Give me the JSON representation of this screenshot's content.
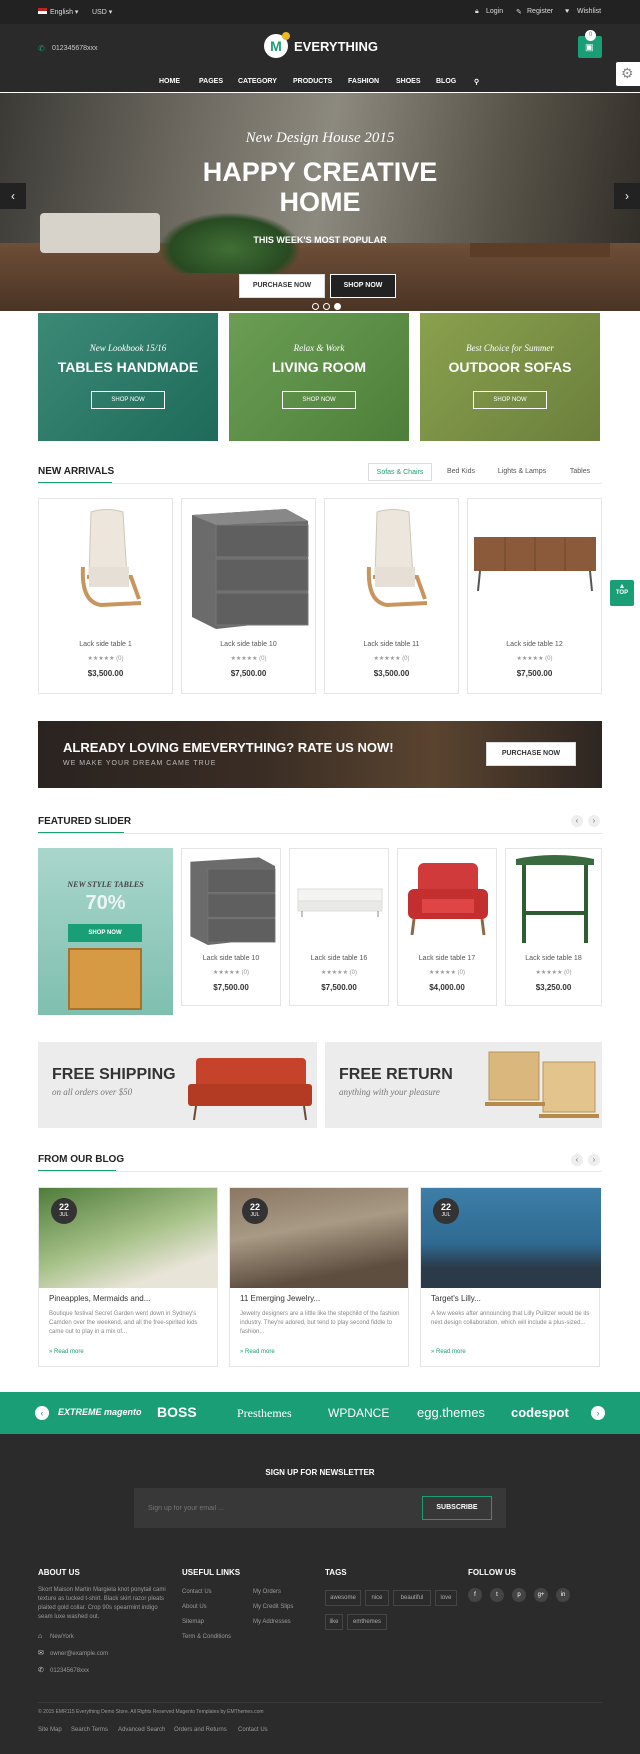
{
  "topbar": {
    "language": "English ▾",
    "currency": "USD ▾",
    "login": "Login",
    "register": "Register",
    "wishlist": "Wishlist"
  },
  "header": {
    "phone": "012345678xxx",
    "logo": "EVERYTHING",
    "cart_count": "0"
  },
  "nav": [
    "HOME",
    "PAGES",
    "CATEGORY",
    "PRODUCTS",
    "FASHION",
    "SHOES",
    "BLOG"
  ],
  "hero": {
    "subtitle": "New Design House 2015",
    "title_line1": "HAPPY CREATIVE",
    "title_line2": "HOME",
    "tagline": "THIS WEEK'S MOST POPULAR",
    "btn1": "PURCHASE NOW",
    "btn2": "SHOP NOW"
  },
  "banners": [
    {
      "sub": "New Lookbook 15/16",
      "title": "TABLES HANDMADE",
      "btn": "SHOP NOW"
    },
    {
      "sub": "Relax & Work",
      "title": "LIVING ROOM",
      "btn": "SHOP NOW"
    },
    {
      "sub": "Best Choice for Summer",
      "title": "OUTDOOR SOFAS",
      "btn": "SHOP NOW"
    }
  ],
  "new_arrivals": {
    "title": "NEW ARRIVALS",
    "tabs": [
      "Sofas & Chairs",
      "Bed Kids",
      "Lights & Lamps",
      "Tables"
    ],
    "products": [
      {
        "name": "Lack side table 1",
        "rating": "★★★★★ (0)",
        "price": "$3,500.00"
      },
      {
        "name": "Lack side table 10",
        "rating": "★★★★★ (0)",
        "price": "$7,500.00"
      },
      {
        "name": "Lack side table 11",
        "rating": "★★★★★ (0)",
        "price": "$3,500.00"
      },
      {
        "name": "Lack side table 12",
        "rating": "★★★★★ (0)",
        "price": "$7,500.00"
      }
    ]
  },
  "rate_banner": {
    "title": "ALREADY LOVING EMEVERYTHING? RATE US NOW!",
    "sub": "WE MAKE YOUR DREAM CAME TRUE",
    "btn": "PURCHASE NOW"
  },
  "featured": {
    "title": "FEATURED SLIDER",
    "promo_sub": "NEW STYLE TABLES",
    "promo_pct": "70%",
    "promo_btn": "SHOP NOW",
    "products": [
      {
        "name": "Lack side table 10",
        "rating": "★★★★★ (0)",
        "price": "$7,500.00"
      },
      {
        "name": "Lack side table 16",
        "rating": "★★★★★ (0)",
        "price": "$7,500.00"
      },
      {
        "name": "Lack side table 17",
        "rating": "★★★★★ (0)",
        "price": "$4,000.00"
      },
      {
        "name": "Lack side table 18",
        "rating": "★★★★★ (0)",
        "price": "$3,250.00"
      }
    ]
  },
  "promos": [
    {
      "title": "FREE SHIPPING",
      "sub": "on all orders over $50"
    },
    {
      "title": "FREE RETURN",
      "sub": "anything with your pleasure"
    }
  ],
  "blog": {
    "title": "FROM OUR BLOG",
    "posts": [
      {
        "day": "22",
        "month": "JUL",
        "title": "Pineapples, Mermaids and...",
        "body": "Boutique festival Secret Garden went down in Sydney's Camden over the weekend, and all the free-spirited kids came out to play in a mix of...",
        "more": "» Read more"
      },
      {
        "day": "22",
        "month": "JUL",
        "title": "11 Emerging Jewelry...",
        "body": "Jewelry designers are a little like the stepchild of the fashion industry. They're adored, but tend to play second fiddle to fashion...",
        "more": "» Read more"
      },
      {
        "day": "22",
        "month": "JUL",
        "title": "Target's Lilly...",
        "body": "A few weeks after announcing that Lilly Pulitzer would be its next design collaboration, which will include a plus-sized...",
        "more": "» Read more"
      }
    ]
  },
  "brands": [
    "EXTREME magento",
    "BOSS",
    "Presthemes",
    "WPDANCE",
    "egg.themes",
    "codespot"
  ],
  "newsletter": {
    "title": "SIGN UP FOR NEWSLETTER",
    "placeholder": "Sign up for your email ...",
    "btn": "SUBSCRIBE"
  },
  "footer": {
    "about_title": "ABOUT US",
    "about_text": "Skort Maison Martin Margiela knot ponytail cami texture as tucked t-shirt. Black skirt razor pleats plaited gold collar. Crop 90s spearmint indigo seam luxe washed out.",
    "about_location": "NewYork",
    "about_email": "owner@example.com",
    "about_phone": "012345678xxx",
    "links_title": "USEFUL LINKS",
    "links_col1": [
      "Contact Us",
      "About Us",
      "Sitemap",
      "Term & Conditions"
    ],
    "links_col2": [
      "My Orders",
      "My Credit Slips",
      "My Addresses"
    ],
    "tags_title": "TAGS",
    "tags": [
      "awesome",
      "nice",
      "beautiful",
      "love",
      "like",
      "emthemes"
    ],
    "follow_title": "FOLLOW US",
    "social": [
      "f",
      "t",
      "p",
      "g+",
      "in"
    ],
    "copyright": "© 2015 EMR115 Everything Demo Store. All Rights Reserved Magento Templates by EMThemes.com",
    "bottom_links": [
      "Site Map",
      "Search Terms",
      "Advanced Search",
      "Orders and Returns",
      "Contact Us"
    ]
  },
  "misc": {
    "back_to_top": "TOP"
  }
}
